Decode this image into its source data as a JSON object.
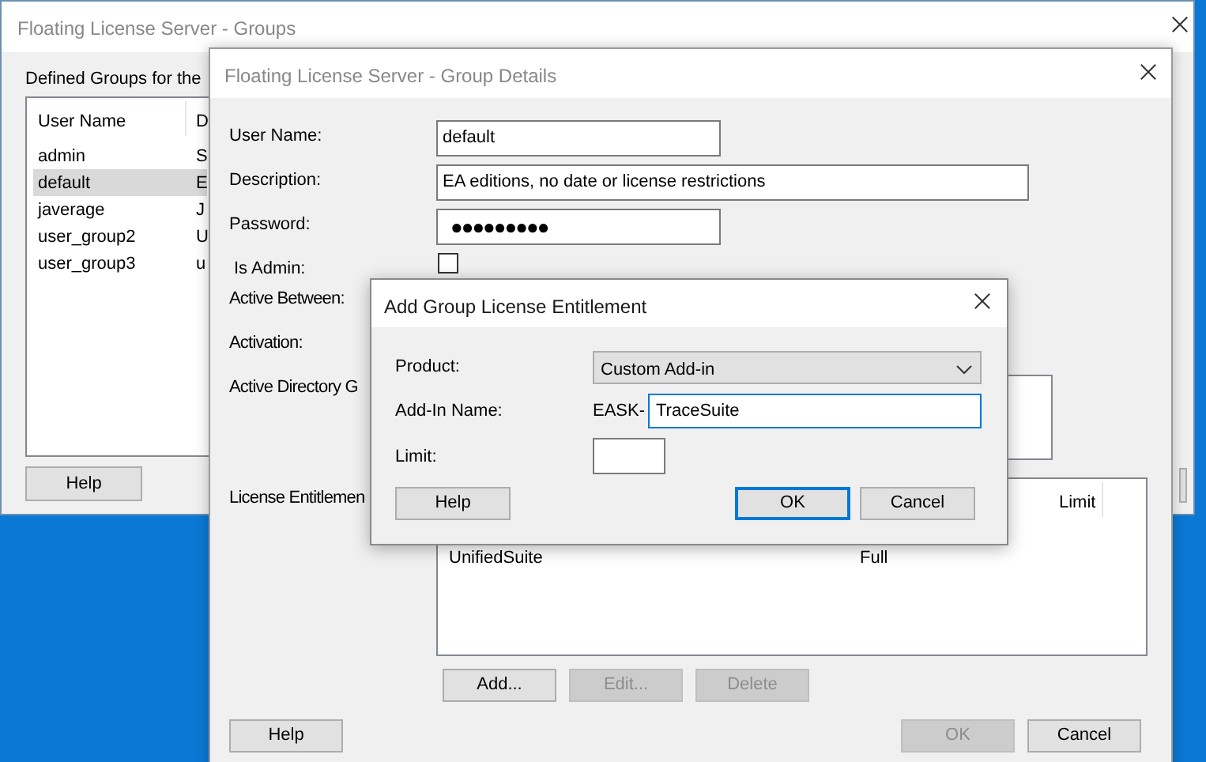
{
  "groups_window": {
    "title": "Floating License Server - Groups",
    "active": false,
    "intro": "Defined Groups for the",
    "columns": [
      "User Name",
      "D"
    ],
    "rows": [
      {
        "cells": [
          "admin",
          "S"
        ],
        "selected": false
      },
      {
        "cells": [
          "default",
          "E"
        ],
        "selected": true
      },
      {
        "cells": [
          "javerage",
          "J"
        ],
        "selected": false
      },
      {
        "cells": [
          "user_group2",
          "U"
        ],
        "selected": false
      },
      {
        "cells": [
          "user_group3",
          "u"
        ],
        "selected": false
      }
    ],
    "help_button": "Help"
  },
  "details_window": {
    "title": "Floating License Server - Group Details",
    "active": false,
    "fields": [
      {
        "label": "User Name:",
        "kind": "text",
        "value": "default"
      },
      {
        "label": "Description:",
        "kind": "wide",
        "value": "EA editions, no date or license restrictions"
      },
      {
        "label": "Password:",
        "kind": "password",
        "value": "●●●●●●●●●"
      }
    ],
    "is_admin": {
      "label": "Is Admin:",
      "checked": false
    },
    "labels": [
      "Active Between:",
      "Activation:",
      "Active Directory G"
    ],
    "entitlements_label": "License Entitlemen",
    "entitlements": {
      "columns": [
        "Limit"
      ],
      "rows": [
        {
          "cells": [
            "UnifiedSuite",
            "Full"
          ]
        }
      ]
    },
    "list_buttons": [
      {
        "label": "Add...",
        "disabled": false
      },
      {
        "label": "Edit...",
        "disabled": true
      },
      {
        "label": "Delete",
        "disabled": true
      }
    ],
    "footer_buttons": [
      {
        "label": "Help",
        "disabled": false
      },
      {
        "label": "OK",
        "disabled": true
      },
      {
        "label": "Cancel",
        "disabled": false
      }
    ]
  },
  "add_dialog": {
    "title": "Add Group License Entitlement",
    "active": true,
    "product": {
      "label": "Product:",
      "value": "Custom Add-in"
    },
    "addin": {
      "label": "Add-In Name:",
      "prefix": "EASK-",
      "value": "TraceSuite"
    },
    "limit": {
      "label": "Limit:"
    },
    "buttons": [
      {
        "label": "Help",
        "default": false
      },
      {
        "label": "OK",
        "default": true
      },
      {
        "label": "Cancel",
        "default": false
      }
    ]
  }
}
